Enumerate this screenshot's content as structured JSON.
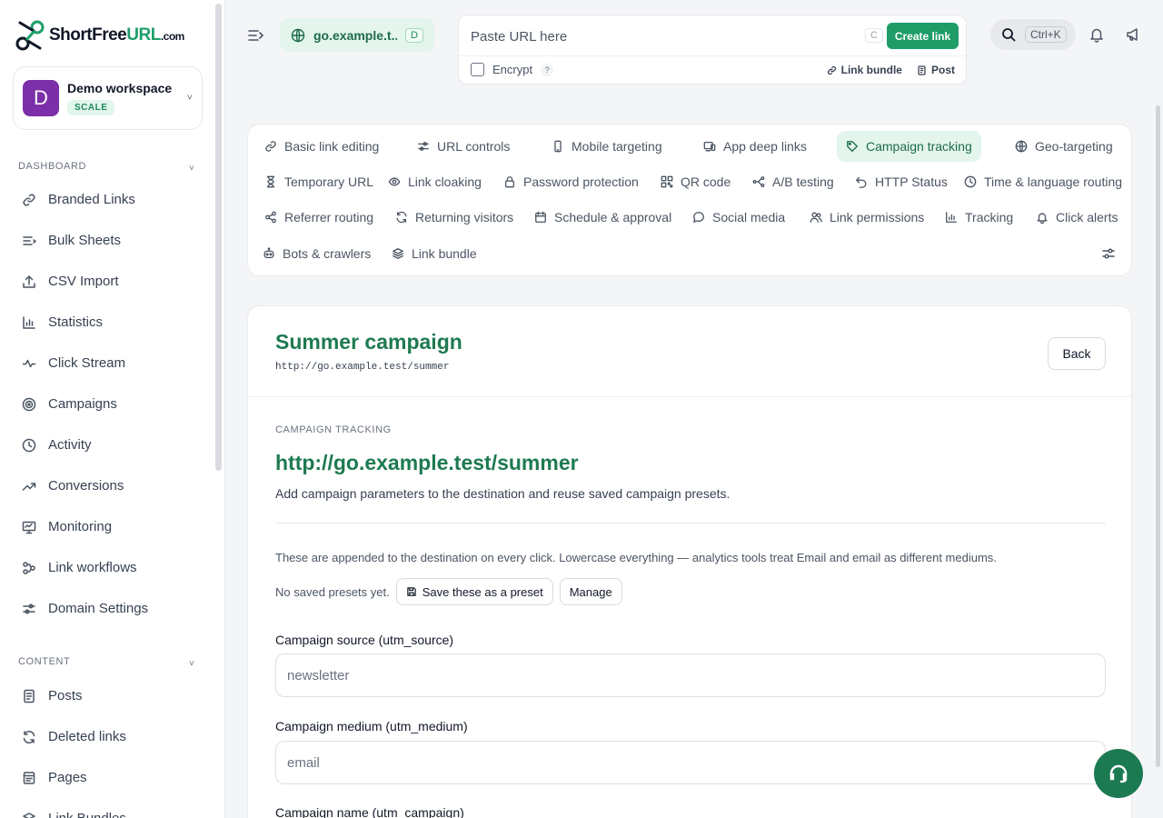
{
  "brand": {
    "name_part1": "ShortFree",
    "name_part2": "URL",
    "name_part3": ".com"
  },
  "workspace": {
    "initial": "D",
    "name": "Demo workspace",
    "plan": "SCALE"
  },
  "sidebar": {
    "dashboard_label": "DASHBOARD",
    "dashboard_items": [
      {
        "label": "Branded Links",
        "icon": "link-icon"
      },
      {
        "label": "Bulk Sheets",
        "icon": "list-icon"
      },
      {
        "label": "CSV Import",
        "icon": "upload-icon"
      },
      {
        "label": "Statistics",
        "icon": "bar-chart-icon"
      },
      {
        "label": "Click Stream",
        "icon": "pulse-icon"
      },
      {
        "label": "Campaigns",
        "icon": "target-icon"
      },
      {
        "label": "Activity",
        "icon": "clock-icon"
      },
      {
        "label": "Conversions",
        "icon": "trend-icon"
      },
      {
        "label": "Monitoring",
        "icon": "monitor-icon"
      },
      {
        "label": "Link workflows",
        "icon": "workflow-icon"
      },
      {
        "label": "Domain Settings",
        "icon": "sliders-icon"
      }
    ],
    "content_label": "CONTENT",
    "content_items": [
      {
        "label": "Posts",
        "icon": "document-icon"
      },
      {
        "label": "Deleted links",
        "icon": "refresh-icon"
      },
      {
        "label": "Pages",
        "icon": "page-icon"
      },
      {
        "label": "Link Bundles",
        "icon": "layers-icon"
      }
    ]
  },
  "topbar": {
    "domain": "go.example.t...",
    "domain_key": "D",
    "url_placeholder": "Paste URL here",
    "url_key": "C",
    "create_label": "Create link",
    "encrypt_label": "Encrypt",
    "help": "?",
    "link_bundle_label": "Link bundle",
    "post_label": "Post",
    "search_shortcut": "Ctrl+K"
  },
  "tabs": [
    {
      "label": "Basic link editing",
      "icon": "link-icon"
    },
    {
      "label": "URL controls",
      "icon": "sliders-icon"
    },
    {
      "label": "Mobile targeting",
      "icon": "phone-icon"
    },
    {
      "label": "App deep links",
      "icon": "devices-icon"
    },
    {
      "label": "Campaign tracking",
      "icon": "tag-icon",
      "active": true
    },
    {
      "label": "Geo-targeting",
      "icon": "globe-icon"
    },
    {
      "label": "Temporary URL",
      "icon": "hourglass-icon"
    },
    {
      "label": "Link cloaking",
      "icon": "eye-icon"
    },
    {
      "label": "Password protection",
      "icon": "lock-icon"
    },
    {
      "label": "QR code",
      "icon": "qr-icon"
    },
    {
      "label": "A/B testing",
      "icon": "split-icon"
    },
    {
      "label": "HTTP Status",
      "icon": "undo-icon"
    },
    {
      "label": "Time & language routing",
      "icon": "clock-icon"
    },
    {
      "label": "Referrer routing",
      "icon": "share-icon"
    },
    {
      "label": "Returning visitors",
      "icon": "refresh-icon"
    },
    {
      "label": "Schedule & approval",
      "icon": "calendar-icon"
    },
    {
      "label": "Social media",
      "icon": "chat-icon"
    },
    {
      "label": "Link permissions",
      "icon": "users-icon"
    },
    {
      "label": "Tracking",
      "icon": "bar-chart-icon"
    },
    {
      "label": "Click alerts",
      "icon": "bell-icon"
    },
    {
      "label": "Bots & crawlers",
      "icon": "bot-icon"
    },
    {
      "label": "Link bundle",
      "icon": "layers-icon"
    }
  ],
  "content": {
    "title": "Summer campaign",
    "short_url": "http://go.example.test/summer",
    "back_label": "Back",
    "kicker": "CAMPAIGN TRACKING",
    "heading_url": "http://go.example.test/summer",
    "description": "Add campaign parameters to the destination and reuse saved campaign presets.",
    "note": "These are appended to the destination on every click. Lowercase everything — analytics tools treat Email and email as different mediums.",
    "presets_text": "No saved presets yet.",
    "save_preset_label": "Save these as a preset",
    "manage_label": "Manage",
    "fields": [
      {
        "label": "Campaign source (utm_source)",
        "placeholder": "newsletter"
      },
      {
        "label": "Campaign medium (utm_medium)",
        "placeholder": "email"
      },
      {
        "label": "Campaign name (utm_campaign)",
        "placeholder": ""
      }
    ]
  },
  "colors": {
    "accent": "#1f9d68",
    "accent_dark": "#1e7a50",
    "accent_bg": "#e3f5ec",
    "avatar": "#7b2fa8"
  }
}
